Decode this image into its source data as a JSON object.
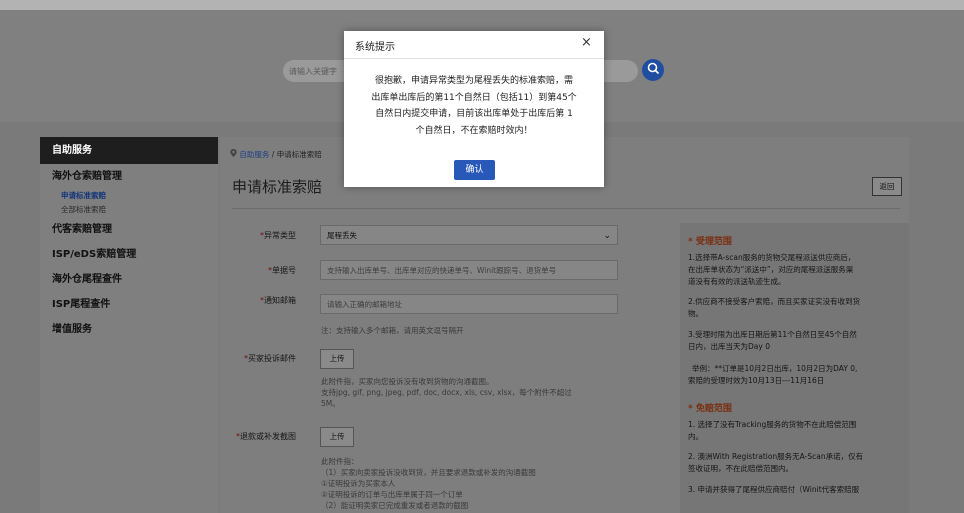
{
  "search": {
    "placeholder": "请输入关键字"
  },
  "sidebar": {
    "header": "自助服务",
    "groups": [
      {
        "label": "海外仓索赔管理",
        "subs": [
          "申请标准索赔",
          "全部标准索赔"
        ]
      },
      {
        "label": "代客索赔管理"
      },
      {
        "label": "ISP/eDS索赔管理"
      },
      {
        "label": "海外仓尾程查件"
      },
      {
        "label": "ISP尾程查件"
      },
      {
        "label": "增值服务"
      }
    ]
  },
  "breadcrumb": {
    "home": "自助服务",
    "sep": "/",
    "current": "申请标准索赔"
  },
  "page": {
    "title": "申请标准索赔",
    "back": "返回"
  },
  "form": {
    "exception_type": {
      "label": "异常类型",
      "value": "尾程丢失"
    },
    "order_no": {
      "label": "单据号",
      "placeholder": "支持输入出库单号、出库单对应的快递单号、Winit跟踪号、退货单号"
    },
    "email": {
      "label": "通知邮箱",
      "placeholder": "请输入正确的邮箱地址",
      "note": "注：支持输入多个邮箱，请用英文逗号隔开"
    },
    "complaint": {
      "label": "买家投诉邮件",
      "button": "上传",
      "hint1": "此附件指，买家向您投诉没有收到货物的沟通截图。",
      "hint2": "支持jpg, gif, png, jpeg, pdf, doc, docx, xls, csv, xlsx，每个附件不超过",
      "hint3": "5M。"
    },
    "refund": {
      "label": "退款或补发截图",
      "button": "上传",
      "hints": [
        "此附件指：",
        "（1）买家向卖家投诉没收到货，并且要求退款或补发的沟通截图",
        "①证明投诉为买家本人",
        "②证明投诉的订单与出库单属于同一个订单",
        "（2）能证明卖家已完成重发或者退款的截图"
      ]
    }
  },
  "info": {
    "scope_title": "* 受理范围",
    "scope_items": [
      "1.选择带A-scan服务的货物交尾程派送供应商后，",
      "在出库单状态为“派送中”，对应的尾程派送服务渠",
      "道没有有效的派送轨迹生成。",
      "2.供应商不接受客户索赔，而且买家证实没有收到货",
      "物。",
      "3.受理时限为出库日期后第11个自然日至45个自然",
      "日内，出库当天为Day 0",
      "举例：**订单是10月2日出库，10月2日为DAY 0,",
      "索赔的受理时效为10月13日---11月16日"
    ],
    "exempt_title": "* 免赔范围",
    "exempt_items": [
      "1. 选择了没有Tracking服务的货物不在此赔偿范围",
      "内。",
      "2. 澳洲With Registration服务无A-Scan承诺，仅有",
      "签收证明，不在此赔偿范围内。",
      "3. 申请并获得了尾程供应商赔付（Winit代客索赔服"
    ]
  },
  "modal": {
    "title": "系统提示",
    "close": "×",
    "lines": [
      "很抱歉，申请异常类型为尾程丢失的标准索赔，需",
      "出库单出库后的第11个自然日（包括11）到第45个",
      "自然日内提交申请，目前该出库单处于出库后第 1",
      "个自然日，不在索赔时效内！"
    ],
    "ok": "确认"
  },
  "colors": {
    "primary": "#2858b8",
    "search_btn": "#1f4ea0",
    "sidebar_header": "#1e1e1e",
    "info_title": "#7a2e10"
  }
}
